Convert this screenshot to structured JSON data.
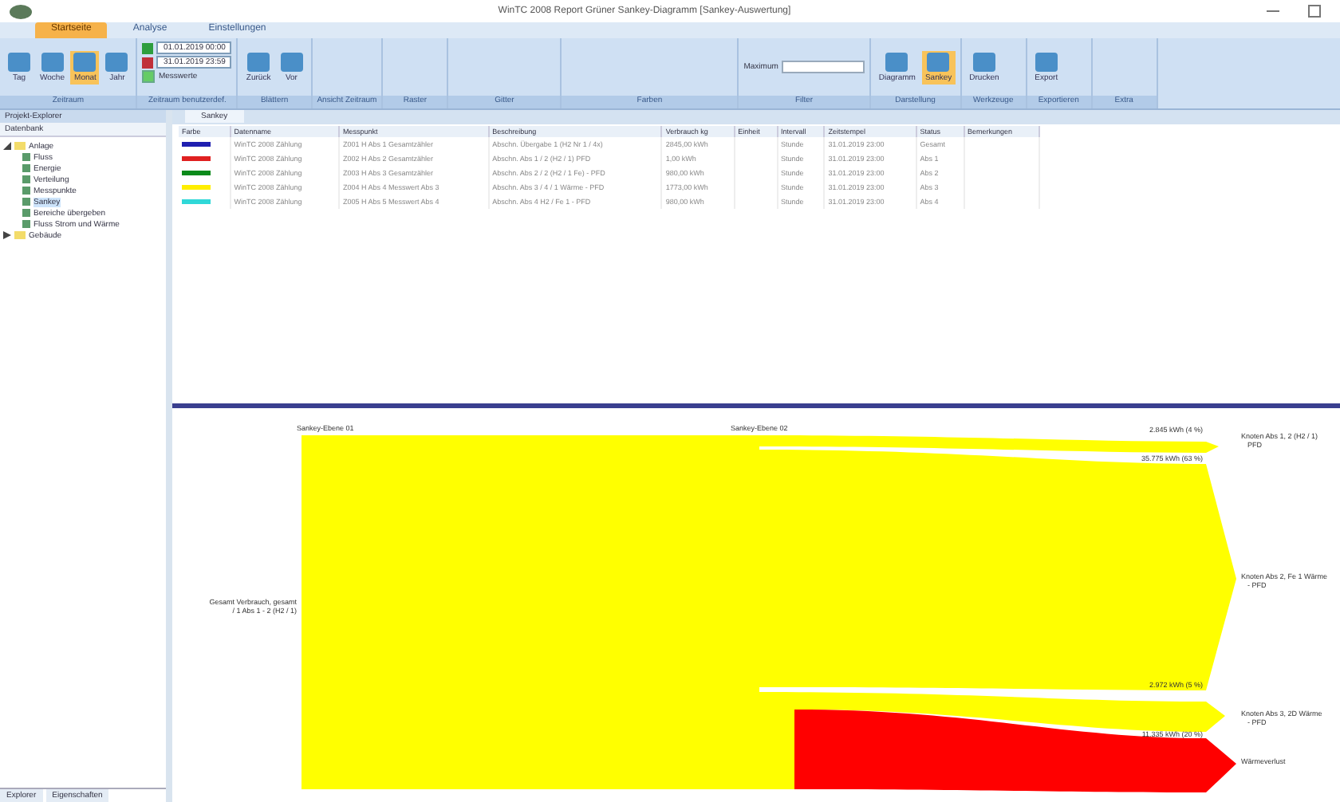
{
  "window": {
    "title": "WinTC 2008 Report Grüner Sankey-Diagramm [Sankey-Auswertung]"
  },
  "tabs": [
    {
      "label": "Startseite",
      "selected": true
    },
    {
      "label": "Analyse",
      "selected": false
    },
    {
      "label": "Einstellungen",
      "selected": false
    }
  ],
  "ribbon": [
    {
      "label": "Zeitraum",
      "items": [
        {
          "kind": "button",
          "label": "Tag",
          "selected": false
        },
        {
          "kind": "button",
          "label": "Woche",
          "selected": false
        },
        {
          "kind": "button",
          "label": "Monat",
          "selected": true
        },
        {
          "kind": "button",
          "label": "Jahr",
          "selected": false
        }
      ]
    },
    {
      "label": "Zeitraum benutzerdef.",
      "items": [
        {
          "kind": "date",
          "value": "01.01.2019 00:00",
          "color": "#2e9e3e"
        },
        {
          "kind": "date",
          "value": "31.01.2019 23:59",
          "color": "#c0303a"
        },
        {
          "kind": "check",
          "label": "Messwerte",
          "checked": true
        }
      ]
    },
    {
      "label": "Blättern",
      "items": [
        {
          "kind": "button",
          "label": "Zurück",
          "selected": false
        },
        {
          "kind": "button",
          "label": "Vor",
          "selected": false
        }
      ]
    },
    {
      "label": "Ansicht Zeitraum"
    },
    {
      "label": "Raster"
    },
    {
      "label": "Gitter"
    },
    {
      "label": "Farben"
    },
    {
      "label": "Filter",
      "items": [
        {
          "kind": "field",
          "label": "Maximum"
        }
      ]
    },
    {
      "label": "Darstellung",
      "items": [
        {
          "kind": "button",
          "label": "Diagramm",
          "selected": false
        },
        {
          "kind": "button",
          "label": "Sankey",
          "selected": true
        }
      ]
    },
    {
      "label": "Werkzeuge",
      "items": [
        {
          "kind": "button",
          "label": "Drucken",
          "selected": false
        }
      ]
    },
    {
      "label": "Exportieren",
      "items": [
        {
          "kind": "button",
          "label": "Export",
          "selected": false
        }
      ]
    },
    {
      "label": "Extra"
    }
  ],
  "sidebar": {
    "title": "Projekt-Explorer",
    "header": "Datenbank",
    "tree": [
      {
        "label": "Anlage",
        "expanded": true,
        "children": [
          {
            "label": "Fluss",
            "selected": false
          },
          {
            "label": "Energie",
            "selected": false
          },
          {
            "label": "Verteilung",
            "selected": false
          },
          {
            "label": "Messpunkte",
            "selected": false
          },
          {
            "label": "Sankey",
            "selected": true
          },
          {
            "label": "Bereiche übergeben",
            "selected": false
          },
          {
            "label": "Fluss Strom und Wärme",
            "selected": false
          }
        ]
      },
      {
        "label": "Gebäude",
        "expanded": false
      }
    ]
  },
  "doc_tab": "Sankey",
  "table": {
    "columns": [
      "Farbe",
      "Datenname",
      "Messpunkt",
      "Beschreibung",
      "Verbrauch kg",
      "Einheit",
      "Intervall",
      "Zeitstempel",
      "Status",
      "Bemerkungen"
    ],
    "rows": [
      {
        "color": "#1f1fb0",
        "cells": [
          "",
          "WinTC 2008 Zählung",
          "Z001 H Abs 1 Gesamtzähler",
          "Abschn. Übergabe 1 (H2 Nr 1 / 4x)",
          "2845,00 kWh",
          "",
          "Stunde",
          "31.01.2019 23:00",
          "Gesamt",
          ""
        ]
      },
      {
        "color": "#e02020",
        "cells": [
          "",
          "WinTC 2008 Zählung",
          "Z002 H Abs 2 Gesamtzähler",
          "Abschn. Abs 1 / 2 (H2 / 1) PFD",
          "1,00 kWh",
          "",
          "Stunde",
          "31.01.2019 23:00",
          "Abs 1",
          ""
        ]
      },
      {
        "color": "#0a8a1a",
        "cells": [
          "",
          "WinTC 2008 Zählung",
          "Z003 H Abs 3 Gesamtzähler",
          "Abschn. Abs 2 / 2 (H2 / 1 Fe) - PFD",
          "980,00 kWh",
          "",
          "Stunde",
          "31.01.2019 23:00",
          "Abs 2",
          ""
        ]
      },
      {
        "color": "#ffee00",
        "cells": [
          "",
          "WinTC 2008 Zählung",
          "Z004 H Abs 4 Messwert Abs 3",
          "Abschn. Abs 3 / 4 / 1 Wärme - PFD",
          "1773,00 kWh",
          "",
          "Stunde",
          "31.01.2019 23:00",
          "Abs 3",
          ""
        ]
      },
      {
        "color": "#30d8d8",
        "cells": [
          "",
          "WinTC 2008 Zählung",
          "Z005 H Abs 5 Messwert Abs 4",
          "Abschn. Abs 4 H2 / Fe 1 - PFD",
          "980,00 kWh",
          "",
          "Stunde",
          "31.01.2019 23:00",
          "Abs 4",
          ""
        ]
      }
    ]
  },
  "sankey": {
    "level_labels": [
      "Sankey-Ebene 01",
      "Sankey-Ebene 02"
    ],
    "source_label": [
      "Gesamt Verbrauch, gesamt",
      "/ 1 Abs 1 - 2 (H2 / 1)"
    ],
    "flow_labels": [
      "2.845 kWh (4 %)",
      "35.775 kWh (63 %)",
      "2.972 kWh (5 %)",
      "11.335 kWh (20 %)"
    ],
    "target_labels": [
      [
        "Knoten Abs 1, 2 (H2 / 1)",
        "PFD"
      ],
      [
        "Knoten Abs 2, Fe 1 Wärme",
        "- PFD"
      ],
      [
        "Knoten Abs 3, 2D Wärme",
        "- PFD"
      ],
      [
        "Wärmeverlust"
      ]
    ]
  },
  "bottom_tabs": [
    "Explorer",
    "Eigenschaften"
  ]
}
